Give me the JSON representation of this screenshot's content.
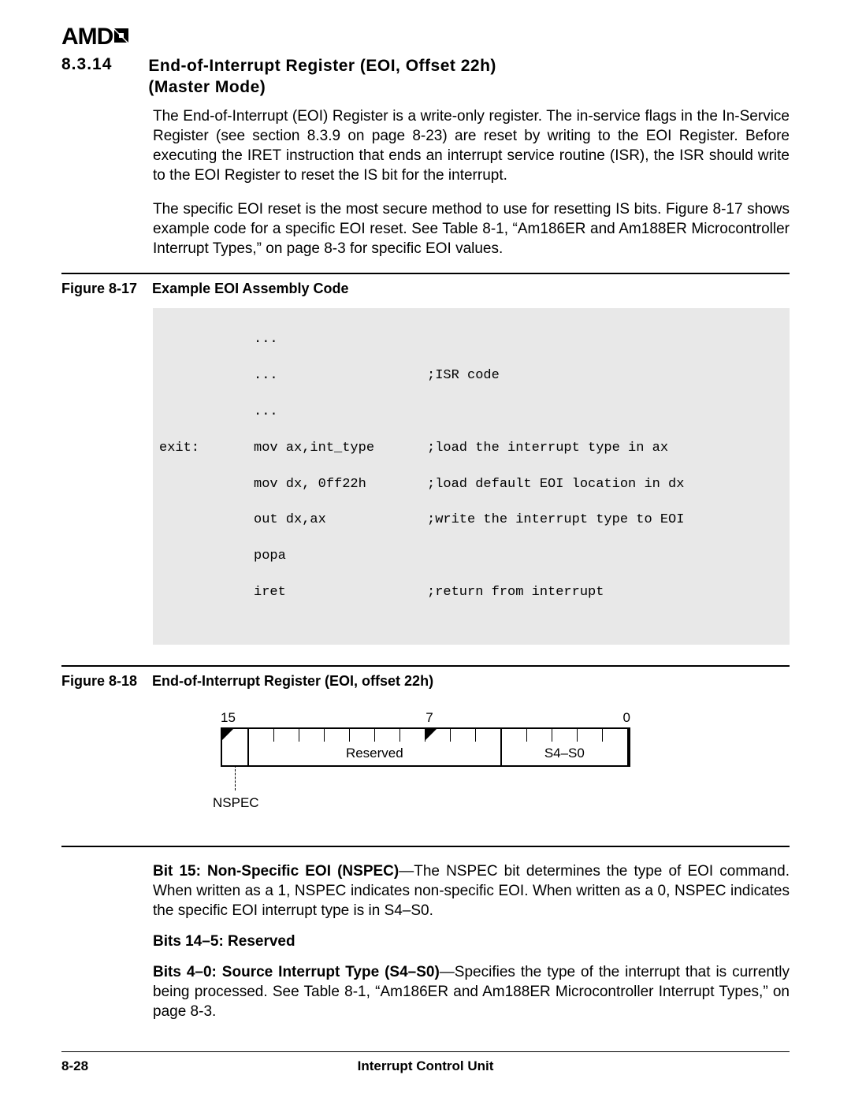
{
  "logo_text": "AMD",
  "section": {
    "number": "8.3.14",
    "title_line1": "End-of-Interrupt Register (EOI, Offset 22h)",
    "title_line2": "(Master Mode)"
  },
  "paragraphs": {
    "p1": "The End-of-Interrupt (EOI) Register is a write-only register. The in-service flags in the In-Service Register (see section 8.3.9 on page 8-23) are reset by writing to the EOI Register. Before executing the IRET instruction that ends an interrupt service routine (ISR), the ISR should write to the EOI Register to reset the IS bit for the interrupt.",
    "p2": "The specific EOI reset is the most secure method to use for resetting IS bits. Figure 8-17 shows example code for a specific EOI reset. See Table 8-1, “Am186ER and Am188ER Microcontroller Interrupt Types,” on page 8-3 for specific EOI values."
  },
  "fig17": {
    "label": "Figure 8-17",
    "title": "Example EOI Assembly Code"
  },
  "code": {
    "r0": {
      "c1": "",
      "c2": "...",
      "c3": ""
    },
    "r1": {
      "c1": "",
      "c2": "...",
      "c3": ";ISR code"
    },
    "r2": {
      "c1": "",
      "c2": "...",
      "c3": ""
    },
    "r3": {
      "c1": "exit:",
      "c2": "mov ax,int_type",
      "c3": ";load the interrupt type in ax"
    },
    "r4": {
      "c1": "",
      "c2": "mov dx, 0ff22h",
      "c3": ";load default EOI location in dx"
    },
    "r5": {
      "c1": "",
      "c2": "out dx,ax",
      "c3": ";write the interrupt type to EOI"
    },
    "r6": {
      "c1": "",
      "c2": "popa",
      "c3": ""
    },
    "r7": {
      "c1": "",
      "c2": "iret",
      "c3": ";return from interrupt"
    }
  },
  "fig18": {
    "label": "Figure 8-18",
    "title": "End-of-Interrupt Register (EOI, offset 22h)"
  },
  "register": {
    "tick15": "15",
    "tick7": "7",
    "tick0": "0",
    "reserved_label": "Reserved",
    "s4s0_label": "S4–S0",
    "nspec_label": "NSPEC"
  },
  "bits": {
    "b15_lead": "Bit 15: Non-Specific EOI (NSPEC)",
    "b15_body": "—The NSPEC bit determines the type of EOI command. When written as a 1, NSPEC indicates non-specific EOI. When written as a 0, NSPEC indicates the specific EOI interrupt type is in S4–S0.",
    "b14_5": "Bits 14–5: Reserved",
    "b4_0_lead": "Bits 4–0: Source Interrupt Type (S4–S0)",
    "b4_0_body": "—Specifies the type of the interrupt that is currently being processed. See Table 8-1, “Am186ER and Am188ER Microcontroller Interrupt Types,” on page 8-3."
  },
  "footer": {
    "page_number": "8-28",
    "title": "Interrupt Control Unit"
  }
}
